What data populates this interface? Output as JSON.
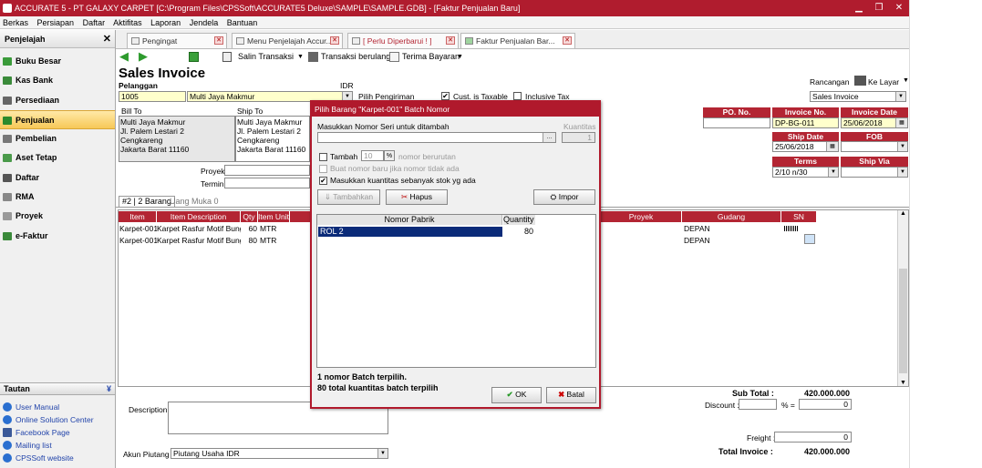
{
  "window": {
    "title": "ACCURATE 5 - PT GALAXY CARPET  [C:\\Program Files\\CPSSoft\\ACCURATE5 Deluxe\\SAMPLE\\SAMPLE.GDB] - [Faktur Penjualan Baru]"
  },
  "menu": [
    "Berkas",
    "Persiapan",
    "Daftar",
    "Aktifitas",
    "Laporan",
    "Jendela",
    "Bantuan"
  ],
  "sidebar": {
    "header": "Penjelajah",
    "items": [
      "Buku Besar",
      "Kas Bank",
      "Persediaan",
      "Penjualan",
      "Pembelian",
      "Aset Tetap",
      "Daftar",
      "RMA",
      "Proyek",
      "e-Faktur"
    ],
    "links_header": "Tautan",
    "links": [
      "User Manual",
      "Online Solution Center",
      "Facebook Page",
      "Mailing list",
      "CPSSoft website"
    ]
  },
  "tabs": [
    "Pengingat",
    "Menu Penjelajah Accur...",
    "[ Perlu Diperbarui ! ]",
    "Faktur Penjualan Bar..."
  ],
  "toolbar": {
    "copy": "Salin Transaksi",
    "recurring": "Transaksi berulang",
    "receive": "Terima Bayaran"
  },
  "form": {
    "title": "Sales Invoice",
    "customer_label": "Pelanggan",
    "currency": "IDR",
    "customer_id": "1005",
    "customer_name": "Multi Jaya Makmur",
    "ship_btn": "Pilih Pengiriman",
    "taxable": "Cust. is Taxable",
    "inclusive": "Inclusive Tax",
    "rancangan_label": "Rancangan",
    "print_target": "Ke Layar",
    "template": "Sales Invoice",
    "bill_to": "Bill To",
    "ship_to": "Ship To",
    "bill_lines": [
      "Multi Jaya Makmur",
      "Jl. Palem Lestari 2",
      "Cengkareng",
      "Jakarta Barat 11160"
    ],
    "ship_lines": [
      "Multi Jaya Makmur",
      "Jl. Palem Lestari 2",
      "Cengkareng",
      "Jakarta Barat 11160"
    ],
    "proyek": "Proyek",
    "termin": "Termin",
    "po_label": "PO. No.",
    "invoice_no_label": "Invoice No.",
    "invoice_no": "DP-BG-011",
    "invoice_date_label": "Invoice Date",
    "invoice_date": "25/06/2018",
    "ship_date_label": "Ship Date",
    "ship_date": "25/06/2018",
    "fob_label": "FOB",
    "terms_label": "Terms",
    "terms": "2/10 n/30",
    "ship_via_label": "Ship Via",
    "subtabs": [
      "#2 | 2 Barang",
      "Uang Muka",
      "0"
    ]
  },
  "grid": {
    "columns": [
      "Item",
      "Item Description",
      "Qty",
      "Item Unit",
      "Proyek",
      "Gudang",
      "SN"
    ],
    "rows": [
      {
        "item": "Karpet-001",
        "desc": "Karpet Rasfur Motif Bunga",
        "qty": "60",
        "unit": "MTR",
        "gudang": "DEPAN"
      },
      {
        "item": "Karpet-001",
        "desc": "Karpet Rasfur Motif Bunga",
        "qty": "80",
        "unit": "MTR",
        "gudang": "DEPAN"
      }
    ]
  },
  "footer": {
    "description_label": "Description:",
    "account_label": "Akun Piutang",
    "account": "Piutang Usaha IDR",
    "subtotal_label": "Sub Total :",
    "subtotal": "420.000.000",
    "discount_label": "Discount :",
    "pct": "% =",
    "discount": "0",
    "freight_label": "Freight :",
    "freight": "0",
    "total_label": "Total Invoice :",
    "total": "420.000.000"
  },
  "dialog": {
    "title": "Pilih Barang \"Karpet-001\" Batch Nomor",
    "serial_label": "Masukkan Nomor Seri untuk ditambah",
    "qty_label": "Kuantitas",
    "qty_value": "1",
    "tambah": "Tambah",
    "tambah_val": "10",
    "urut": "nomor berurutan",
    "baru": "Buat nomor baru jika nomor tidak ada",
    "stok": "Masukkan kuantitas sebanyak stok yg ada",
    "add_btn": "Tambahkan",
    "del_btn": "Hapus",
    "import_btn": "Impor",
    "col_no": "Nomor Pabrik",
    "col_qty": "Quantity",
    "rows": [
      {
        "no": "ROL 2",
        "qty": "80"
      }
    ],
    "summary1": "1 nomor Batch terpilih.",
    "summary2": "80 total kuantitas batch terpilih",
    "ok": "OK",
    "cancel": "Batal"
  }
}
